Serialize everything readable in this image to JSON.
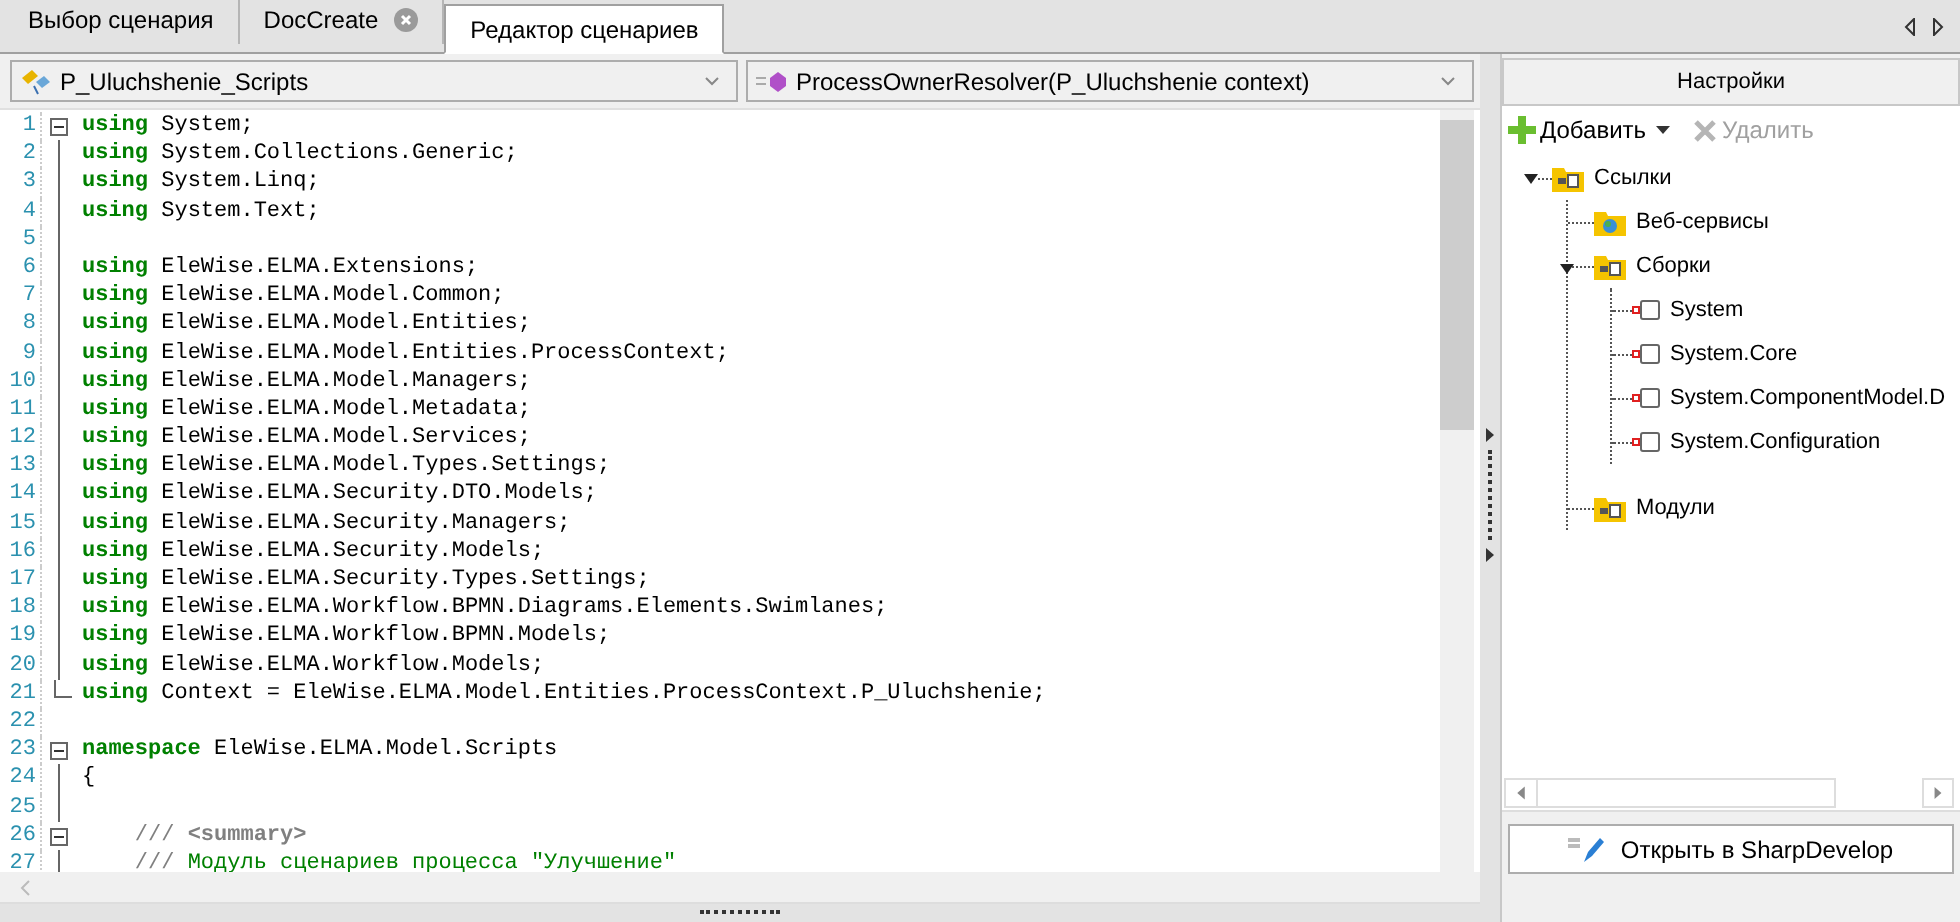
{
  "tabs": [
    {
      "label": "Выбор сценария",
      "selected": false,
      "closable": false
    },
    {
      "label": "DocCreate",
      "selected": false,
      "closable": true
    },
    {
      "label": "Редактор сценариев",
      "selected": true,
      "closable": false
    }
  ],
  "editor": {
    "class_dropdown": "P_Uluchshenie_Scripts",
    "member_dropdown": "ProcessOwnerResolver(P_Uluchshenie context)",
    "lines": [
      {
        "number": "1",
        "kind": "fold-start",
        "tokens": [
          {
            "kind": "keyword",
            "text": "using"
          },
          {
            "kind": "plain",
            "text": " System;"
          }
        ]
      },
      {
        "number": "2",
        "kind": "code",
        "tokens": [
          {
            "kind": "keyword",
            "text": "using"
          },
          {
            "kind": "plain",
            "text": " System.Collections.Generic;"
          }
        ]
      },
      {
        "number": "3",
        "kind": "code",
        "tokens": [
          {
            "kind": "keyword",
            "text": "using"
          },
          {
            "kind": "plain",
            "text": " System.Linq;"
          }
        ]
      },
      {
        "number": "4",
        "kind": "code",
        "tokens": [
          {
            "kind": "keyword",
            "text": "using"
          },
          {
            "kind": "plain",
            "text": " System.Text;"
          }
        ]
      },
      {
        "number": "5",
        "kind": "code"
      },
      {
        "number": "6",
        "kind": "code",
        "tokens": [
          {
            "kind": "keyword",
            "text": "using"
          },
          {
            "kind": "plain",
            "text": " EleWise.ELMA.Extensions;"
          }
        ]
      },
      {
        "number": "7",
        "kind": "code",
        "tokens": [
          {
            "kind": "keyword",
            "text": "using"
          },
          {
            "kind": "plain",
            "text": " EleWise.ELMA.Model.Common;"
          }
        ]
      },
      {
        "number": "8",
        "kind": "code",
        "tokens": [
          {
            "kind": "keyword",
            "text": "using"
          },
          {
            "kind": "plain",
            "text": " EleWise.ELMA.Model.Entities;"
          }
        ]
      },
      {
        "number": "9",
        "kind": "code",
        "tokens": [
          {
            "kind": "keyword",
            "text": "using"
          },
          {
            "kind": "plain",
            "text": " EleWise.ELMA.Model.Entities.ProcessContext;"
          }
        ]
      },
      {
        "number": "10",
        "kind": "code",
        "tokens": [
          {
            "kind": "keyword",
            "text": "using"
          },
          {
            "kind": "plain",
            "text": " EleWise.ELMA.Model.Managers;"
          }
        ]
      },
      {
        "number": "11",
        "kind": "code",
        "tokens": [
          {
            "kind": "keyword",
            "text": "using"
          },
          {
            "kind": "plain",
            "text": " EleWise.ELMA.Model.Metadata;"
          }
        ]
      },
      {
        "number": "12",
        "kind": "code",
        "tokens": [
          {
            "kind": "keyword",
            "text": "using"
          },
          {
            "kind": "plain",
            "text": " EleWise.ELMA.Model.Services;"
          }
        ]
      },
      {
        "number": "13",
        "kind": "code",
        "tokens": [
          {
            "kind": "keyword",
            "text": "using"
          },
          {
            "kind": "plain",
            "text": " EleWise.ELMA.Model.Types.Settings;"
          }
        ]
      },
      {
        "number": "14",
        "kind": "code",
        "tokens": [
          {
            "kind": "keyword",
            "text": "using"
          },
          {
            "kind": "plain",
            "text": " EleWise.ELMA.Security.DTO.Models;"
          }
        ]
      },
      {
        "number": "15",
        "kind": "code",
        "tokens": [
          {
            "kind": "keyword",
            "text": "using"
          },
          {
            "kind": "plain",
            "text": " EleWise.ELMA.Security.Managers;"
          }
        ]
      },
      {
        "number": "16",
        "kind": "code",
        "tokens": [
          {
            "kind": "keyword",
            "text": "using"
          },
          {
            "kind": "plain",
            "text": " EleWise.ELMA.Security.Models;"
          }
        ]
      },
      {
        "number": "17",
        "kind": "code",
        "tokens": [
          {
            "kind": "keyword",
            "text": "using"
          },
          {
            "kind": "plain",
            "text": " EleWise.ELMA.Security.Types.Settings;"
          }
        ]
      },
      {
        "number": "18",
        "kind": "code",
        "tokens": [
          {
            "kind": "keyword",
            "text": "using"
          },
          {
            "kind": "plain",
            "text": " EleWise.ELMA.Workflow.BPMN.Diagrams.Elements.Swimlanes;"
          }
        ]
      },
      {
        "number": "19",
        "kind": "code",
        "tokens": [
          {
            "kind": "keyword",
            "text": "using"
          },
          {
            "kind": "plain",
            "text": " EleWise.ELMA.Workflow.BPMN.Models;"
          }
        ]
      },
      {
        "number": "20",
        "kind": "code",
        "tokens": [
          {
            "kind": "keyword",
            "text": "using"
          },
          {
            "kind": "plain",
            "text": " EleWise.ELMA.Workflow.Models;"
          }
        ]
      },
      {
        "number": "21",
        "kind": "fold-end",
        "tokens": [
          {
            "kind": "keyword",
            "text": "using"
          },
          {
            "kind": "plain",
            "text": " Context = EleWise.ELMA.Model.Entities.ProcessContext.P_Uluchshenie;"
          }
        ]
      },
      {
        "number": "22",
        "kind": "code"
      },
      {
        "number": "23",
        "kind": "fold-start",
        "tokens": [
          {
            "kind": "keyword",
            "text": "namespace"
          },
          {
            "kind": "plain",
            "text": " EleWise.ELMA.Model.Scripts"
          }
        ]
      },
      {
        "number": "24",
        "kind": "code",
        "tokens": [
          {
            "kind": "plain",
            "text": "{"
          }
        ]
      },
      {
        "number": "25",
        "kind": "code"
      },
      {
        "number": "26",
        "kind": "fold-start",
        "tokens": [
          {
            "kind": "doc",
            "text": "    /// "
          },
          {
            "kind": "doctag",
            "text": "<summary>"
          }
        ]
      },
      {
        "number": "27",
        "kind": "code",
        "tokens": [
          {
            "kind": "doc",
            "text": "    /// "
          },
          {
            "kind": "comment",
            "text": "Модуль сценариев процесса \"Улучшение\""
          }
        ]
      }
    ]
  },
  "settings": {
    "title": "Настройки",
    "add_button": {
      "label": "Добавить",
      "disabled": false
    },
    "delete_button": {
      "label": "Удалить",
      "disabled": true
    },
    "tree": [
      {
        "label": "Ссылки",
        "kind": "group",
        "expanded": true,
        "children": [
          {
            "label": "Веб-сервисы",
            "kind": "web"
          },
          {
            "label": "Сборки",
            "kind": "group",
            "expanded": true,
            "children": [
              {
                "label": "System",
                "kind": "reference"
              },
              {
                "label": "System.Core",
                "kind": "reference"
              },
              {
                "label": "System.ComponentModel.D",
                "kind": "reference"
              },
              {
                "label": "System.Configuration",
                "kind": "reference"
              }
            ]
          },
          {
            "label": "Модули",
            "kind": "group"
          }
        ]
      }
    ],
    "open_button": {
      "label": "Открыть в SharpDevelop"
    }
  }
}
